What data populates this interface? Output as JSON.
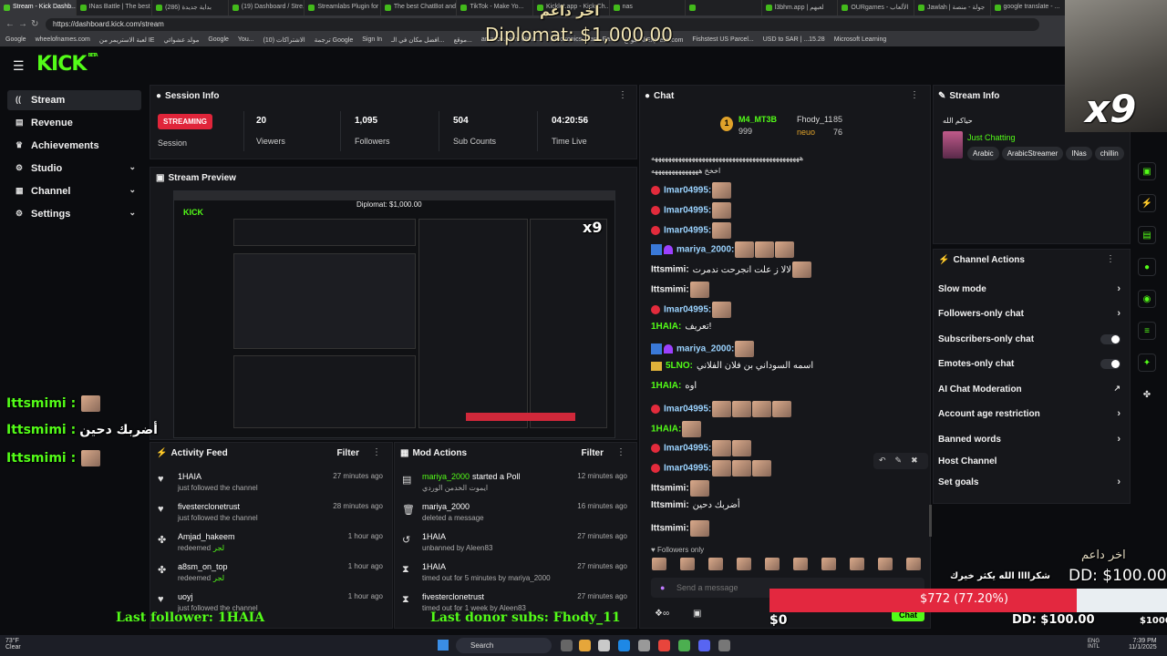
{
  "browser": {
    "tabs": [
      "Stream - Kick Dashb...",
      "INas Battle | The best",
      "(286) بداية جديدة",
      "(19) Dashboard / Stre...",
      "Streamlabs Plugin for ...",
      "The best ChatBot and ...",
      "TikTok - Make Yo...",
      "Kicklet.app - Kick Ch...",
      "nas",
      "",
      "l3bhm.app | لعبهم",
      "OURgames - الألعاب",
      "Jawlah | جولة - منصة",
      "google translate - ..."
    ],
    "url": "https://dashboard.kick.com/stream",
    "bookmarks": [
      "Google",
      "wheelofnames.com",
      "لعبة الاستريمر من IE",
      "مولد عشوائي",
      "Google",
      "You...",
      "الاشتراكات (10)",
      "ترجمة Google",
      "Sign In",
      "افضل مكان في الـ...",
      "موقع...",
      "amazon.com: Onlin...",
      "Electronics, Cars, Fa...",
      "موقع AliExpress.com",
      "Fishstest US Parcel...",
      "USD to SAR | ...15.28",
      "Microsoft Learning"
    ]
  },
  "overlay": {
    "top_donor_label": "اخر داعم",
    "top_donor_amount": "Diplomat: $1,000.00",
    "x9": "x9",
    "chat_overlay": [
      {
        "user": "Ittsmimi :",
        "text": ""
      },
      {
        "user": "Ittsmimi :",
        "text": "أضربك دحين"
      },
      {
        "user": "Ittsmimi :",
        "text": ""
      }
    ],
    "last_follower": "Last follower: 1HAIA",
    "last_donor": "Last donor subs: Fhody_11",
    "thanks": "شكراااا الله يكثر خيرك",
    "donor_label": "اخر داعم",
    "dd_amount": "DD: $100.00",
    "goal_text": "$772 (77.20%)",
    "goal_percent": 77.2,
    "goal_zero": "$0",
    "dd_bottom": "DD: $100.00",
    "goal_end": "$1000"
  },
  "sidebar": {
    "items": [
      {
        "label": "Stream",
        "icon": "broadcast-icon"
      },
      {
        "label": "Revenue",
        "icon": "wallet-icon"
      },
      {
        "label": "Achievements",
        "icon": "trophy-icon"
      },
      {
        "label": "Studio",
        "icon": "gear-icon"
      },
      {
        "label": "Channel",
        "icon": "box-icon"
      },
      {
        "label": "Settings",
        "icon": "gear-icon"
      }
    ]
  },
  "session": {
    "title": "Session Info",
    "badge": "STREAMING",
    "badge_label": "Session",
    "stats": [
      {
        "value": "20",
        "label": "Viewers"
      },
      {
        "value": "1,095",
        "label": "Followers"
      },
      {
        "value": "504",
        "label": "Sub Counts"
      },
      {
        "value": "04:20:56",
        "label": "Time Live"
      }
    ]
  },
  "preview": {
    "title": "Stream Preview"
  },
  "activity": {
    "title": "Activity Feed",
    "filter": "Filter",
    "rows": [
      {
        "name": "1HAIA",
        "sub": "just followed the channel",
        "time": "27 minutes ago",
        "icon": "heart-icon"
      },
      {
        "name": "fivesterclonetrust",
        "sub": "just followed the channel",
        "time": "28 minutes ago",
        "icon": "heart-icon"
      },
      {
        "name": "Amjad_hakeem",
        "sub": "redeemed",
        "hl": "لجر",
        "time": "1 hour ago",
        "icon": "points-icon"
      },
      {
        "name": "a8sm_on_top",
        "sub": "redeemed",
        "hl": "لجر",
        "time": "1 hour ago",
        "icon": "points-icon"
      },
      {
        "name": "uoyj",
        "sub": "just followed the channel",
        "time": "1 hour ago",
        "icon": "heart-icon"
      }
    ]
  },
  "mod": {
    "title": "Mod Actions",
    "filter": "Filter",
    "rows": [
      {
        "name": "mariya_2000",
        "action": "started a Poll",
        "sub": "ايموت الخدمن الوردي",
        "time": "12 minutes ago",
        "icon": "poll-icon"
      },
      {
        "name": "mariya_2000",
        "action": "",
        "sub": "deleted a message",
        "time": "16 minutes ago",
        "icon": "trash-icon"
      },
      {
        "name": "1HAIA",
        "action": "",
        "sub": "unbanned by Aleen83",
        "time": "27 minutes ago",
        "icon": "undo-icon"
      },
      {
        "name": "1HAIA",
        "action": "",
        "sub": "timed out for 5 minutes by mariya_2000",
        "time": "27 minutes ago",
        "icon": "hourglass-icon"
      },
      {
        "name": "fivesterclonetrust",
        "action": "",
        "sub": "timed out for 1 week by Aleen83",
        "time": "27 minutes ago",
        "icon": "hourglass-icon"
      }
    ]
  },
  "chat": {
    "title": "Chat",
    "leader1_name": "M4_MT3B",
    "leader1_count": "999",
    "leader2_name": "Fhody_11",
    "leader2_count": "85",
    "leader3_name": "neuo",
    "leader3_count": "76",
    "pinned1": "ههههههههههههههههههههههههههههههههههههههههههههه",
    "pinned2": "اخخخ ههههههههههههههه",
    "lines": [
      {
        "user": "Imar04995:",
        "text": "",
        "emotes": 1,
        "color": "blue",
        "badge": "red"
      },
      {
        "user": "Imar04995:",
        "text": "",
        "emotes": 1,
        "color": "blue",
        "badge": "red"
      },
      {
        "user": "Imar04995:",
        "text": "",
        "emotes": 1,
        "color": "blue",
        "badge": "red"
      },
      {
        "user": "mariya_2000:",
        "text": "",
        "emotes": 3,
        "color": "blue",
        "badge": "blue"
      },
      {
        "user": "Ittsmimi:",
        "text": "لالا ز علت انجرحت ندمرت",
        "emotes": 1,
        "color": "white",
        "badge": ""
      },
      {
        "user": "Ittsmimi:",
        "text": "",
        "emotes": 1,
        "color": "white",
        "badge": ""
      },
      {
        "user": "Imar04995:",
        "text": "",
        "emotes": 1,
        "color": "blue",
        "badge": "red"
      },
      {
        "user": "1HAIA:",
        "text": "تعريف!",
        "emotes": 0,
        "color": "lime",
        "badge": ""
      },
      {
        "user": "mariya_2000:",
        "text": "",
        "emotes": 1,
        "color": "blue",
        "badge": "blue"
      },
      {
        "user": "5LNO:",
        "text": "اسمه السوداني بن فلان الفلاني",
        "emotes": 0,
        "color": "lime",
        "badge": "gold"
      },
      {
        "user": "1HAIA:",
        "text": "اوه",
        "emotes": 0,
        "color": "lime",
        "badge": ""
      },
      {
        "user": "Imar04995:",
        "text": "",
        "emotes": 4,
        "color": "blue",
        "badge": "red"
      },
      {
        "user": "1HAIA:",
        "text": "",
        "emotes": 1,
        "color": "lime",
        "badge": ""
      },
      {
        "user": "Imar04995:",
        "text": "",
        "emotes": 2,
        "color": "blue",
        "badge": "red"
      },
      {
        "user": "Imar04995:",
        "text": "",
        "emotes": 3,
        "color": "blue",
        "badge": "red"
      },
      {
        "user": "Ittsmimi:",
        "text": "",
        "emotes": 1,
        "color": "white",
        "badge": ""
      },
      {
        "user": "Ittsmimi:",
        "text": "أضربك دحين",
        "emotes": 0,
        "color": "white",
        "badge": ""
      },
      {
        "user": "Ittsmimi:",
        "text": "",
        "emotes": 1,
        "color": "white",
        "badge": ""
      }
    ],
    "followers_only": "Followers only",
    "placeholder": "Send a message",
    "send": "Chat"
  },
  "stream_info": {
    "title": "Stream Info",
    "stream_title": "حياكم الله",
    "category": "Just Chatting",
    "tags": [
      "Arabic",
      "ArabicStreamer",
      "INas",
      "chillin"
    ]
  },
  "actions": {
    "title": "Channel Actions",
    "items": [
      {
        "label": "Slow mode",
        "kind": "chevron"
      },
      {
        "label": "Followers-only chat",
        "kind": "chevron"
      },
      {
        "label": "Subscribers-only chat",
        "kind": "toggle"
      },
      {
        "label": "Emotes-only chat",
        "kind": "toggle"
      },
      {
        "label": "AI Chat Moderation",
        "kind": "external"
      },
      {
        "label": "Account age restriction",
        "kind": "chevron"
      },
      {
        "label": "Banned words",
        "kind": "chevron"
      },
      {
        "label": "Host Channel",
        "kind": "none"
      },
      {
        "label": "Set goals",
        "kind": "chevron"
      }
    ]
  },
  "taskbar": {
    "search": "Search",
    "weather_temp": "73°F",
    "weather_desc": "Clear",
    "lang": "ENG",
    "lang2": "INTL",
    "time": "7:39 PM",
    "date": "11/1/2025"
  }
}
